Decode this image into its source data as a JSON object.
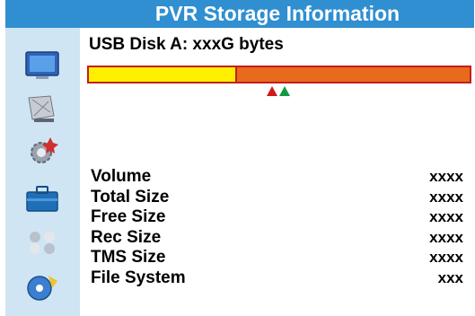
{
  "header": {
    "title": "PVR Storage Information"
  },
  "sidebar": {
    "icons": [
      "tv-icon",
      "satellite-dish-icon",
      "settings-gear-icon",
      "toolbox-icon",
      "games-icon",
      "media-disk-icon"
    ]
  },
  "disk": {
    "label": "USB Disk A: xxxG bytes",
    "used_fraction": 0.39
  },
  "info": [
    {
      "label": "Volume",
      "value": "xxxx"
    },
    {
      "label": "Total Size",
      "value": "xxxx"
    },
    {
      "label": "Free Size",
      "value": "xxxx"
    },
    {
      "label": "Rec Size",
      "value": "xxxx"
    },
    {
      "label": "TMS Size",
      "value": "xxxx"
    },
    {
      "label": "File System",
      "value": "xxx"
    }
  ],
  "colors": {
    "header_bg": "#2f8fd0",
    "sidebar_bg": "#cfe5f4",
    "used": "#ffef00",
    "free": "#e86a1c",
    "bar_border": "#c0201b",
    "marker_red": "#d11818",
    "marker_green": "#139a43"
  }
}
